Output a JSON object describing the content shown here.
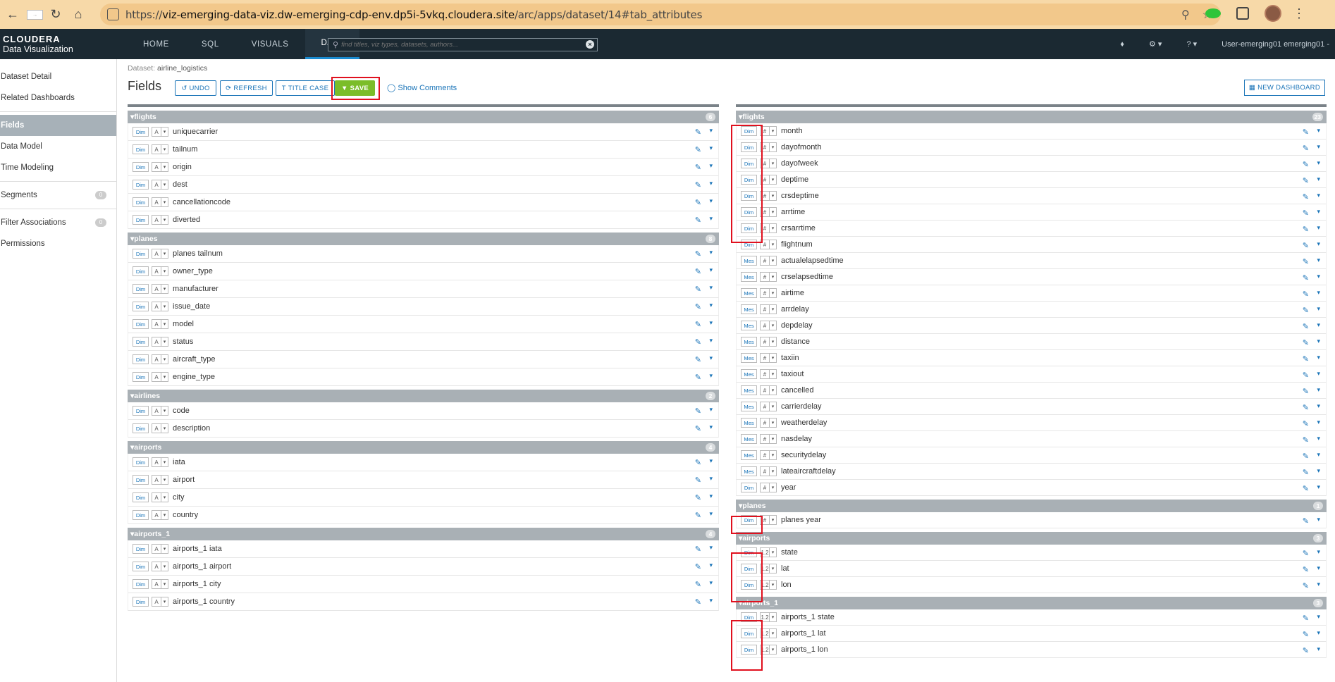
{
  "browser": {
    "url_prefix": "https://",
    "url_host": "viz-emerging-data-viz.dw-emerging-cdp-env.dp5i-5vkq.cloudera.site",
    "url_path": "/arc/apps/dataset/14#tab_attributes"
  },
  "brand": {
    "line1": "CLOUDERA",
    "line2": "Data Visualization"
  },
  "nav": {
    "tabs": [
      "HOME",
      "SQL",
      "VISUALS",
      "DATA"
    ],
    "active": "DATA",
    "search_placeholder": "find titles, viz types, datasets, authors...",
    "user": "User-emerging01  emerging01 -"
  },
  "sidebar": {
    "items": [
      {
        "label": "Dataset Detail"
      },
      {
        "label": "Related Dashboards"
      },
      {
        "label": "Fields"
      },
      {
        "label": "Data Model"
      },
      {
        "label": "Time Modeling"
      },
      {
        "label": "Segments",
        "badge": "0"
      },
      {
        "label": "Filter Associations",
        "badge": "0"
      },
      {
        "label": "Permissions"
      }
    ]
  },
  "header": {
    "crumb_label": "Dataset:",
    "crumb_value": "airline_logistics",
    "title": "Fields",
    "undo": "UNDO",
    "refresh": "REFRESH",
    "title_case": "TITLE CASE",
    "save": "SAVE",
    "show_comments": "Show Comments",
    "new_dashboard": "NEW DASHBOARD"
  },
  "left_panel": [
    {
      "name": "flights",
      "count": "6",
      "fields": [
        {
          "role": "Dim",
          "type": "A",
          "name": "uniquecarrier"
        },
        {
          "role": "Dim",
          "type": "A",
          "name": "tailnum"
        },
        {
          "role": "Dim",
          "type": "A",
          "name": "origin"
        },
        {
          "role": "Dim",
          "type": "A",
          "name": "dest"
        },
        {
          "role": "Dim",
          "type": "A",
          "name": "cancellationcode"
        },
        {
          "role": "Dim",
          "type": "A",
          "name": "diverted"
        }
      ]
    },
    {
      "name": "planes",
      "count": "8",
      "fields": [
        {
          "role": "Dim",
          "type": "A",
          "name": "planes tailnum"
        },
        {
          "role": "Dim",
          "type": "A",
          "name": "owner_type"
        },
        {
          "role": "Dim",
          "type": "A",
          "name": "manufacturer"
        },
        {
          "role": "Dim",
          "type": "A",
          "name": "issue_date"
        },
        {
          "role": "Dim",
          "type": "A",
          "name": "model"
        },
        {
          "role": "Dim",
          "type": "A",
          "name": "status"
        },
        {
          "role": "Dim",
          "type": "A",
          "name": "aircraft_type"
        },
        {
          "role": "Dim",
          "type": "A",
          "name": "engine_type"
        }
      ]
    },
    {
      "name": "airlines",
      "count": "2",
      "fields": [
        {
          "role": "Dim",
          "type": "A",
          "name": "code"
        },
        {
          "role": "Dim",
          "type": "A",
          "name": "description"
        }
      ]
    },
    {
      "name": "airports",
      "count": "4",
      "fields": [
        {
          "role": "Dim",
          "type": "A",
          "name": "iata"
        },
        {
          "role": "Dim",
          "type": "A",
          "name": "airport"
        },
        {
          "role": "Dim",
          "type": "A",
          "name": "city"
        },
        {
          "role": "Dim",
          "type": "A",
          "name": "country"
        }
      ]
    },
    {
      "name": "airports_1",
      "count": "4",
      "fields": [
        {
          "role": "Dim",
          "type": "A",
          "name": "airports_1 iata"
        },
        {
          "role": "Dim",
          "type": "A",
          "name": "airports_1 airport"
        },
        {
          "role": "Dim",
          "type": "A",
          "name": "airports_1 city"
        },
        {
          "role": "Dim",
          "type": "A",
          "name": "airports_1 country"
        }
      ]
    }
  ],
  "right_panel": [
    {
      "name": "flights",
      "count": "23",
      "fields": [
        {
          "role": "Dim",
          "type": "#",
          "name": "month"
        },
        {
          "role": "Dim",
          "type": "#",
          "name": "dayofmonth"
        },
        {
          "role": "Dim",
          "type": "#",
          "name": "dayofweek"
        },
        {
          "role": "Dim",
          "type": "#",
          "name": "deptime"
        },
        {
          "role": "Dim",
          "type": "#",
          "name": "crsdeptime"
        },
        {
          "role": "Dim",
          "type": "#",
          "name": "arrtime"
        },
        {
          "role": "Dim",
          "type": "#",
          "name": "crsarrtime"
        },
        {
          "role": "Dim",
          "type": "#",
          "name": "flightnum"
        },
        {
          "role": "Mes",
          "type": "#",
          "name": "actualelapsedtime"
        },
        {
          "role": "Mes",
          "type": "#",
          "name": "crselapsedtime"
        },
        {
          "role": "Mes",
          "type": "#",
          "name": "airtime"
        },
        {
          "role": "Mes",
          "type": "#",
          "name": "arrdelay"
        },
        {
          "role": "Mes",
          "type": "#",
          "name": "depdelay"
        },
        {
          "role": "Mes",
          "type": "#",
          "name": "distance"
        },
        {
          "role": "Mes",
          "type": "#",
          "name": "taxiin"
        },
        {
          "role": "Mes",
          "type": "#",
          "name": "taxiout"
        },
        {
          "role": "Mes",
          "type": "#",
          "name": "cancelled"
        },
        {
          "role": "Mes",
          "type": "#",
          "name": "carrierdelay"
        },
        {
          "role": "Mes",
          "type": "#",
          "name": "weatherdelay"
        },
        {
          "role": "Mes",
          "type": "#",
          "name": "nasdelay"
        },
        {
          "role": "Mes",
          "type": "#",
          "name": "securitydelay"
        },
        {
          "role": "Mes",
          "type": "#",
          "name": "lateaircraftdelay"
        },
        {
          "role": "Dim",
          "type": "#",
          "name": "year"
        }
      ]
    },
    {
      "name": "planes",
      "count": "1",
      "fields": [
        {
          "role": "Dim",
          "type": "#",
          "name": "planes year"
        }
      ]
    },
    {
      "name": "airports",
      "count": "3",
      "fields": [
        {
          "role": "Dim",
          "type": "1.2",
          "name": "state"
        },
        {
          "role": "Dim",
          "type": "1.2",
          "name": "lat"
        },
        {
          "role": "Dim",
          "type": "1.2",
          "name": "lon"
        }
      ]
    },
    {
      "name": "airports_1",
      "count": "3",
      "fields": [
        {
          "role": "Dim",
          "type": "1.2",
          "name": "airports_1 state"
        },
        {
          "role": "Dim",
          "type": "1.2",
          "name": "airports_1 lat"
        },
        {
          "role": "Dim",
          "type": "1.2",
          "name": "airports_1 lon"
        }
      ]
    }
  ]
}
